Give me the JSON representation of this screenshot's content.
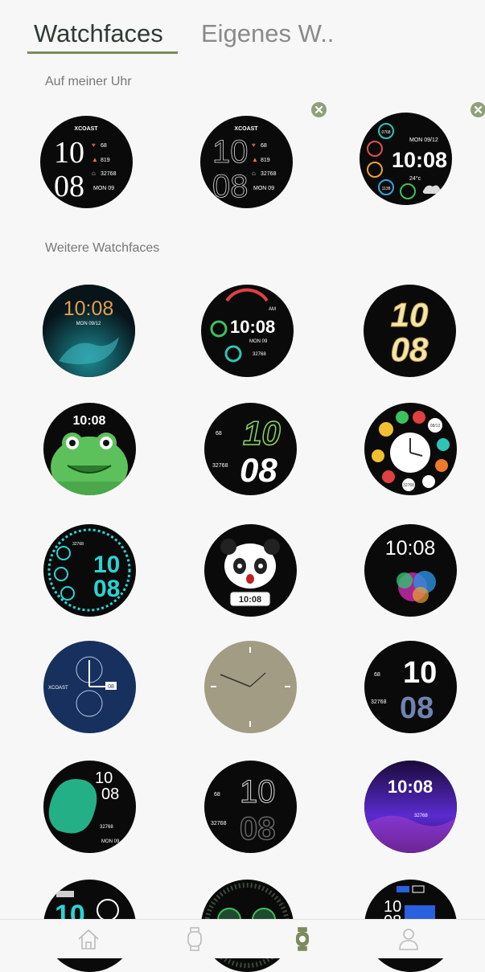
{
  "tabs": [
    {
      "label": "Watchfaces",
      "active": true
    },
    {
      "label": "Eigenes W..",
      "active": false
    }
  ],
  "sections": {
    "on_watch": "Auf meiner Uhr",
    "more": "Weitere Watchfaces"
  },
  "faces": {
    "w1": {
      "brand": "XCOAST",
      "hour": "10",
      "min": "08",
      "hr": "68",
      "kcal": "819",
      "steps": "32768",
      "date": "MON 09"
    },
    "w2": {
      "brand": "XCOAST",
      "hour": "10",
      "min": "08",
      "hr": "68",
      "kcal": "819",
      "steps": "32768",
      "date": "MON 09"
    },
    "w3": {
      "time": "10:08",
      "date": "MON 09/12",
      "temp": "24°c",
      "a": "0768",
      "b": "1138"
    },
    "f1": {
      "time": "10:08",
      "date": "MON 09/12"
    },
    "f2": {
      "time": "10:08",
      "date": "MON 09",
      "am": "AM",
      "steps": "32768"
    },
    "f3": {
      "hour": "10",
      "min": "08"
    },
    "f4": {
      "time": "10:08"
    },
    "f5": {
      "hr": "68",
      "hour": "10",
      "min": "08",
      "steps": "32768"
    },
    "f6": {
      "date": "08/12",
      "steps": "32768"
    },
    "f7": {
      "hour": "10",
      "min": "08",
      "steps": "32768"
    },
    "f8": {
      "time": "10:08"
    },
    "f9": {
      "time": "10:08"
    },
    "f10": {
      "brand": "XCOAST",
      "date": "08"
    },
    "f12": {
      "hr": "68",
      "hour": "10",
      "min": "08",
      "steps": "32768"
    },
    "f13": {
      "hour": "10",
      "min": "08",
      "steps": "32768",
      "date": "MON 09"
    },
    "f14": {
      "hr": "68",
      "hour": "10",
      "min": "08",
      "steps": "32768"
    },
    "f15": {
      "time": "10:08",
      "steps": "32768"
    },
    "f16": {
      "hour": "10"
    },
    "f18": {
      "hour": "10",
      "min": "08"
    }
  },
  "colors": {
    "accent": "#7b8b5e",
    "badge": "#8fa07a",
    "nav_active": "#7b8b5e",
    "nav_inactive": "#bbbbbb"
  },
  "nav": [
    "home-icon",
    "watch-outline-icon",
    "watchface-icon",
    "profile-icon"
  ]
}
